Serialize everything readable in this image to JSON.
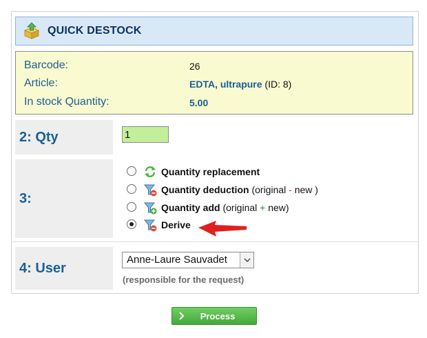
{
  "header": {
    "title": "QUICK DESTOCK",
    "icon": "box-upload-icon"
  },
  "info": {
    "barcode_label": "Barcode:",
    "barcode_value": "26",
    "article_label": "Article:",
    "article_value": "EDTA, ultrapure",
    "article_id": "(ID: 8)",
    "stock_label": "In stock Quantity:",
    "stock_value": "5.00"
  },
  "step2": {
    "label": "2: Qty",
    "qty_value": "1"
  },
  "step3": {
    "label": "3:",
    "options": [
      {
        "label": "Quantity replacement",
        "suffix": "",
        "icon": "refresh-icon",
        "checked": false
      },
      {
        "label": "Quantity deduction",
        "suffix_before": "(original ",
        "op": "-",
        "suffix_after": " new )",
        "icon": "funnel-minus-icon",
        "checked": false
      },
      {
        "label": "Quantity add",
        "suffix_before": "(original ",
        "op": "+",
        "suffix_after": " new)",
        "icon": "funnel-plus-icon",
        "checked": false
      },
      {
        "label": "Derive",
        "icon": "funnel-minus-icon",
        "checked": true
      }
    ]
  },
  "step4": {
    "label": "4: User",
    "selected_user": "Anne-Laure Sauvadet",
    "hint": "(responsible for the request)"
  },
  "actions": {
    "process_label": "Process"
  },
  "colors": {
    "accent_blue": "#1a5e97",
    "button_green": "#45a83a",
    "arrow_red": "#e02020"
  }
}
